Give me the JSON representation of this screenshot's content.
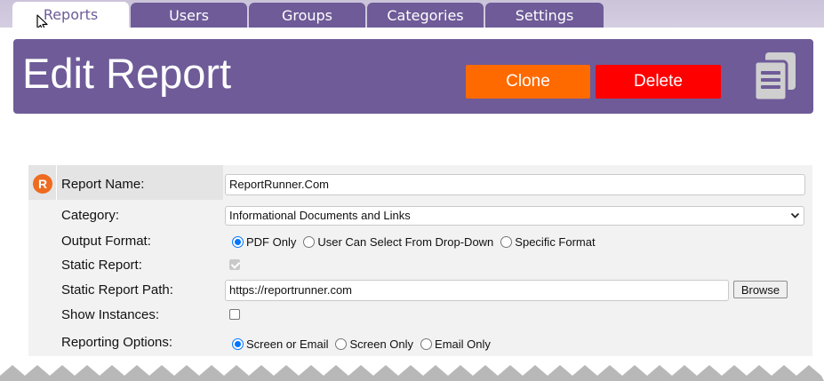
{
  "tabs": [
    {
      "label": "Reports",
      "active": true
    },
    {
      "label": "Users",
      "active": false
    },
    {
      "label": "Groups",
      "active": false
    },
    {
      "label": "Categories",
      "active": false
    },
    {
      "label": "Settings",
      "active": false
    }
  ],
  "header": {
    "title": "Edit Report",
    "clone_label": "Clone",
    "delete_label": "Delete",
    "icon": "copy-icon"
  },
  "form": {
    "logo_letter": "R",
    "report_name": {
      "label": "Report Name:",
      "value": "ReportRunner.Com"
    },
    "category": {
      "label": "Category:",
      "value": "Informational Documents and Links"
    },
    "output_format": {
      "label": "Output Format:",
      "options": [
        "PDF Only",
        "User Can Select From Drop-Down",
        "Specific Format"
      ],
      "selected": "PDF Only"
    },
    "static_report": {
      "label": "Static Report:",
      "checked": true,
      "disabled": true
    },
    "static_report_path": {
      "label": "Static Report Path:",
      "value": "https://reportrunner.com",
      "browse_label": "Browse"
    },
    "show_instances": {
      "label": "Show Instances:",
      "checked": false
    },
    "reporting_options": {
      "label": "Reporting Options:",
      "options": [
        "Screen or Email",
        "Screen Only",
        "Email Only"
      ],
      "selected": "Screen or Email"
    }
  },
  "colors": {
    "brand_purple": "#6e5b98",
    "clone": "#ff6a00",
    "delete": "#ff0000",
    "logo": "#ee6b1f"
  }
}
